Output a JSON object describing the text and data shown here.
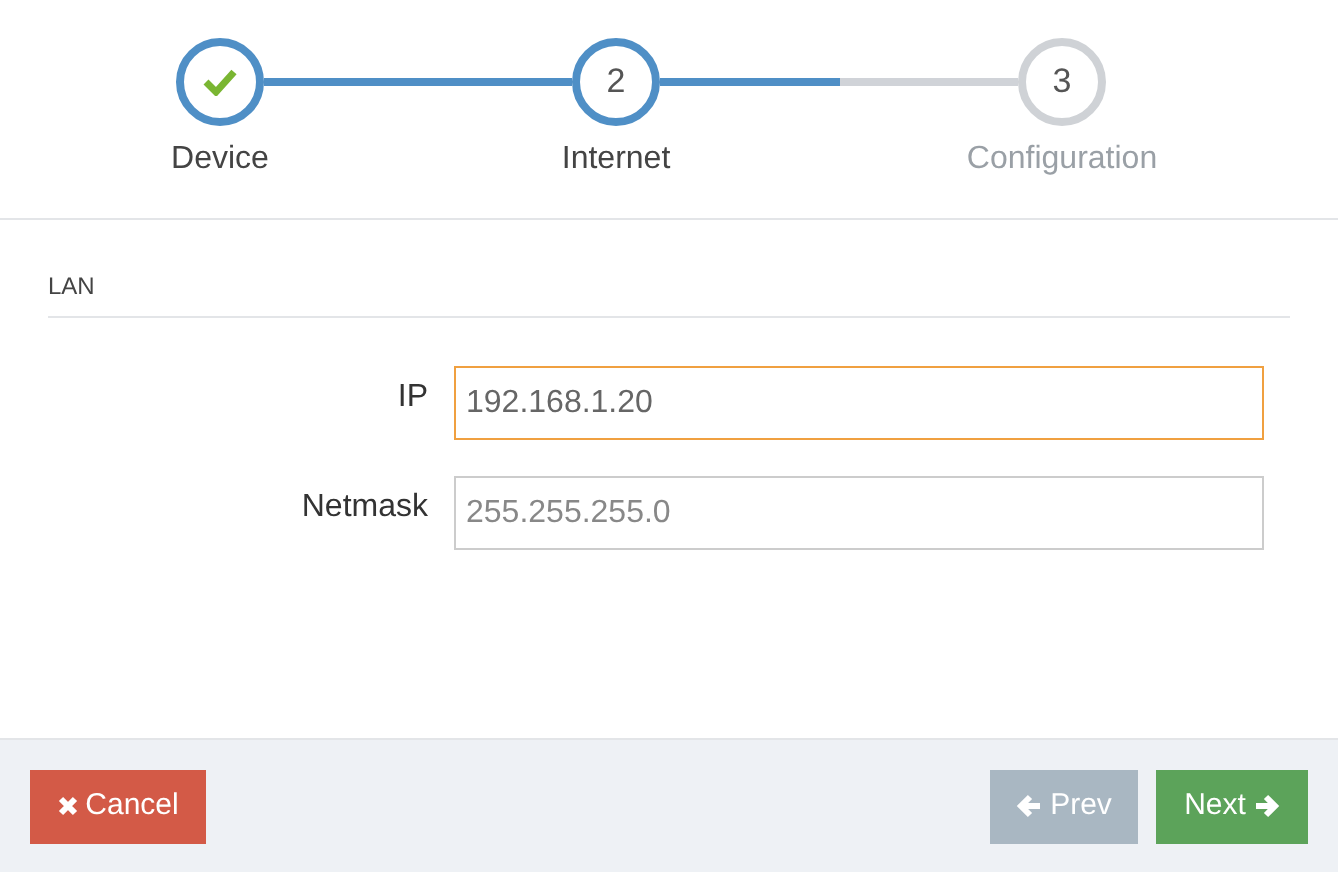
{
  "steps": [
    {
      "label": "Device",
      "kind": "done"
    },
    {
      "label": "Internet",
      "kind": "current",
      "number": "2"
    },
    {
      "label": "Configuration",
      "kind": "upcoming",
      "number": "3"
    }
  ],
  "connectors": [
    {
      "level": 1
    },
    {
      "level": 0.5
    }
  ],
  "section": {
    "title": "LAN"
  },
  "fields": [
    {
      "label": "IP",
      "value": "192.168.1.20",
      "focused": true
    },
    {
      "label": "Netmask",
      "placeholder": "255.255.255.0",
      "focused": false
    }
  ],
  "buttons": [
    {
      "label": "Cancel",
      "kind": "cancel",
      "disabled": false
    },
    {
      "label": "Prev",
      "kind": "prev",
      "disabled": true
    },
    {
      "label": "Next",
      "kind": "next",
      "disabled": false
    }
  ]
}
